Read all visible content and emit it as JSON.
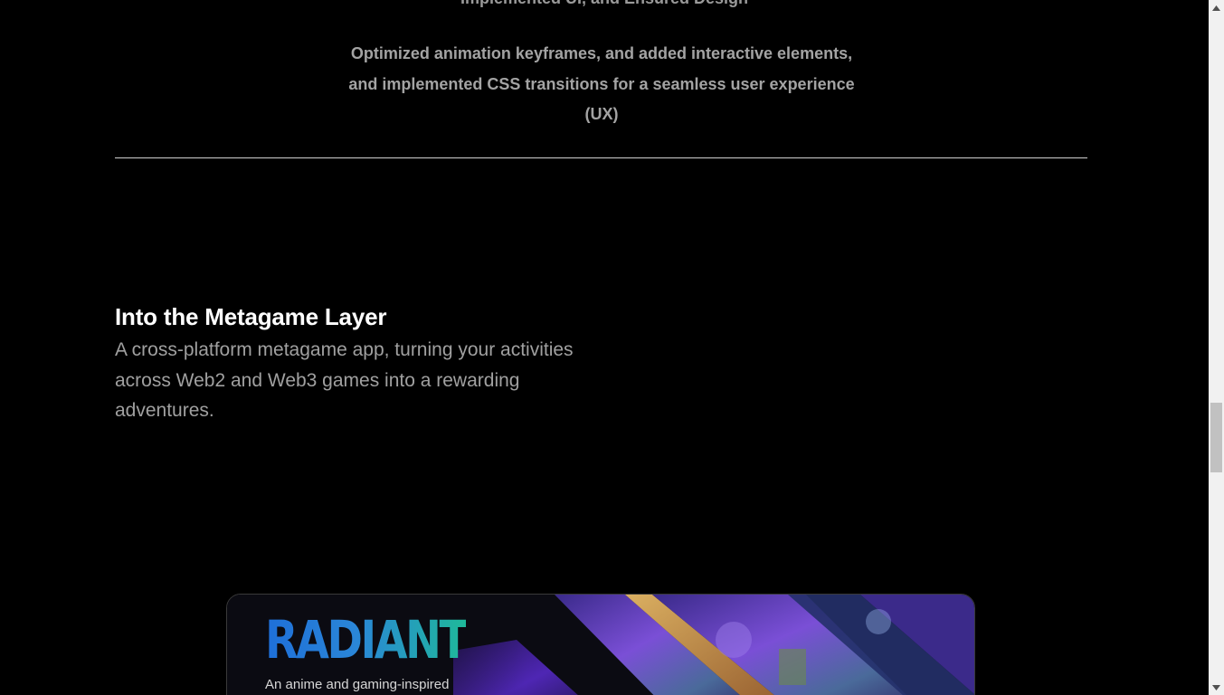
{
  "previous_section": {
    "cutoff_text": "Implemented UI, and Ensured Design",
    "description": "Optimized animation keyframes, and added interactive elements, and implemented CSS transitions for a seamless user experience (UX)"
  },
  "project": {
    "title": "Into the Metagame Layer",
    "description": "A cross-platform metagame app, turning your activities across Web2 and Web3 games into a rewarding adventures."
  },
  "card": {
    "logo_text": "RADIANT",
    "tagline": "An anime and gaming-inspired",
    "colors": {
      "logo_start": "#1e6fd9",
      "logo_end": "#1fb99a",
      "art_purple": "#5a2bd0",
      "art_gold": "#d9a24a"
    }
  },
  "scrollbar": {
    "up_icon": "scroll-up-arrow-icon",
    "down_icon": "scroll-down-arrow-icon"
  }
}
